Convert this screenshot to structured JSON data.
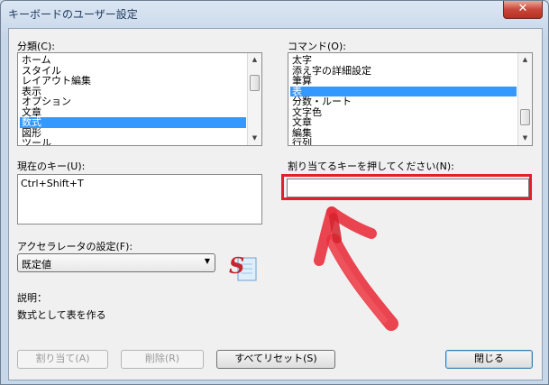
{
  "window": {
    "title": "キーボードのユーザー設定",
    "close_glyph": "✕"
  },
  "categories": {
    "label": "分類(C):",
    "items": [
      "ホーム",
      "スタイル",
      "レイアウト編集",
      "表示",
      "オプション",
      "文章",
      "数式",
      "図形",
      "ツール"
    ],
    "selected": "数式"
  },
  "commands": {
    "label": "コマンド(O):",
    "items": [
      "太字",
      "添え字の詳細設定",
      "筆算",
      "表",
      "分数・ルート",
      "文字色",
      "文章",
      "編集",
      "行列"
    ],
    "selected": "表"
  },
  "current_keys": {
    "label": "現在のキー(U):",
    "items": [
      "Ctrl+Shift+T"
    ]
  },
  "new_key": {
    "label": "割り当てるキーを押してください(N):",
    "value": ""
  },
  "accelerator": {
    "label": "アクセラレータの設定(F):",
    "value": "既定値",
    "app_icon": "s-logo-document-icon"
  },
  "description": {
    "label": "説明：",
    "text": "数式として表を作る"
  },
  "buttons": {
    "assign": "割り当て(A)",
    "remove": "削除(R)",
    "reset_all": "すべてリセット(S)",
    "close": "閉じる"
  },
  "annotation": {
    "highlight_color": "#e3202a",
    "arrow_color": "#e8313d"
  }
}
